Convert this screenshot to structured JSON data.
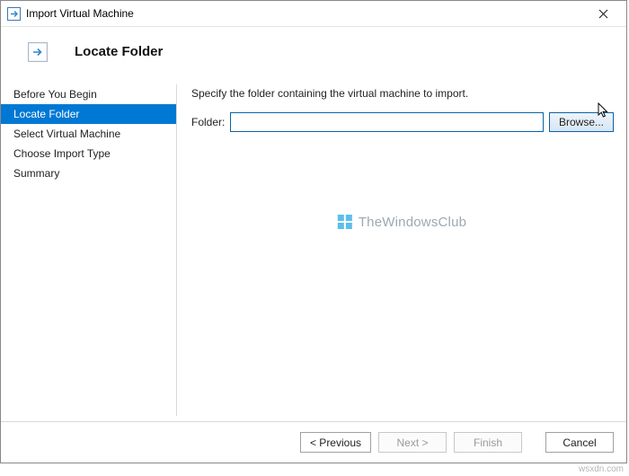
{
  "window": {
    "title": "Import Virtual Machine"
  },
  "header": {
    "heading": "Locate Folder"
  },
  "sidebar": {
    "steps": [
      "Before You Begin",
      "Locate Folder",
      "Select Virtual Machine",
      "Choose Import Type",
      "Summary"
    ],
    "activeIndex": 1
  },
  "content": {
    "instruction": "Specify the folder containing the virtual machine to import.",
    "folderLabel": "Folder:",
    "folderValue": "",
    "browseLabel": "Browse..."
  },
  "footer": {
    "previous": "< Previous",
    "next": "Next >",
    "finish": "Finish",
    "cancel": "Cancel"
  },
  "watermark": {
    "text": "TheWindowsClub"
  },
  "attribution": "wsxdn.com"
}
